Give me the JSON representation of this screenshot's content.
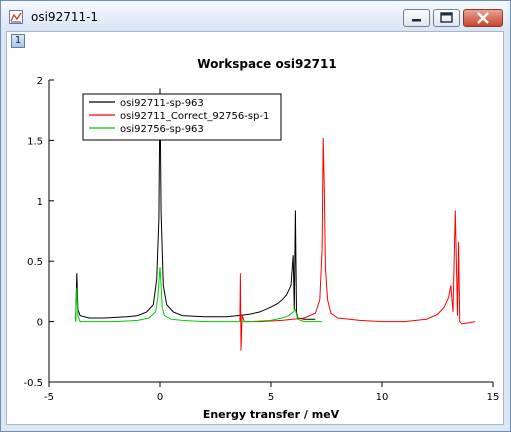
{
  "window": {
    "title": "osi92711-1",
    "tab_label": "1",
    "icons": {
      "app": "graph-icon",
      "minimize": "minimize-icon",
      "maximize": "maximize-icon",
      "close": "close-icon"
    }
  },
  "chart_data": {
    "type": "line",
    "title": "Workspace osi92711",
    "xlabel": "Energy transfer / meV",
    "ylabel": "",
    "xlim": [
      -5,
      15
    ],
    "ylim": [
      -0.5,
      2
    ],
    "x_ticks": [
      -5,
      0,
      5,
      10,
      15
    ],
    "y_ticks": [
      -0.5,
      0,
      0.5,
      1,
      1.5,
      2
    ],
    "grid": false,
    "legend_position": "top-left",
    "series": [
      {
        "name": "osi92711-sp-963",
        "color": "#000000",
        "x": [
          -3.8,
          -3.75,
          -3.7,
          -3.6,
          -3.2,
          -2.5,
          -1.5,
          -1.0,
          -0.6,
          -0.3,
          -0.15,
          -0.05,
          0.0,
          0.05,
          0.15,
          0.3,
          0.6,
          1.0,
          2.0,
          3.0,
          3.5,
          4.0,
          4.5,
          5.0,
          5.3,
          5.5,
          5.7,
          5.8,
          5.9,
          6.0,
          6.05,
          6.1,
          6.15,
          6.2,
          6.5,
          7.0
        ],
        "y": [
          0.0,
          0.4,
          0.1,
          0.05,
          0.03,
          0.03,
          0.04,
          0.05,
          0.08,
          0.14,
          0.35,
          0.85,
          1.93,
          0.9,
          0.3,
          0.14,
          0.08,
          0.05,
          0.04,
          0.04,
          0.05,
          0.06,
          0.08,
          0.12,
          0.15,
          0.18,
          0.22,
          0.26,
          0.3,
          0.55,
          0.1,
          0.92,
          0.08,
          0.03,
          0.02,
          0.02
        ]
      },
      {
        "name": "osi92711_Correct_92756-sp-1",
        "color": "#ff0000",
        "x": [
          3.6,
          3.62,
          3.65,
          3.7,
          3.8,
          4.5,
          5.5,
          6.5,
          7.0,
          7.2,
          7.3,
          7.35,
          7.4,
          7.45,
          7.55,
          7.7,
          8.0,
          9.0,
          10.0,
          11.0,
          12.0,
          12.5,
          12.8,
          13.0,
          13.1,
          13.2,
          13.3,
          13.4,
          13.45,
          13.5,
          13.6,
          14.2
        ],
        "y": [
          0.0,
          0.4,
          -0.24,
          0.05,
          0.0,
          0.0,
          0.01,
          0.03,
          0.07,
          0.18,
          0.6,
          1.52,
          1.1,
          0.45,
          0.18,
          0.07,
          0.03,
          0.01,
          0.0,
          0.0,
          0.02,
          0.06,
          0.12,
          0.2,
          0.3,
          0.08,
          0.92,
          0.05,
          0.66,
          0.0,
          -0.02,
          0.0
        ]
      },
      {
        "name": "osi92756-sp-963",
        "color": "#00cc00",
        "x": [
          -3.8,
          -3.75,
          -3.7,
          -3.6,
          -2.0,
          -1.0,
          -0.5,
          -0.2,
          -0.1,
          0.0,
          0.05,
          0.1,
          0.2,
          0.5,
          1.0,
          2.0,
          3.0,
          4.0,
          5.0,
          5.5,
          5.8,
          6.0,
          6.1,
          6.2,
          6.5,
          7.3
        ],
        "y": [
          0.0,
          0.28,
          0.05,
          0.0,
          0.0,
          0.01,
          0.03,
          0.08,
          0.2,
          0.45,
          0.3,
          0.12,
          0.05,
          0.02,
          0.01,
          0.0,
          0.0,
          0.0,
          0.01,
          0.03,
          0.05,
          0.08,
          0.1,
          0.02,
          0.0,
          0.0
        ]
      }
    ]
  }
}
